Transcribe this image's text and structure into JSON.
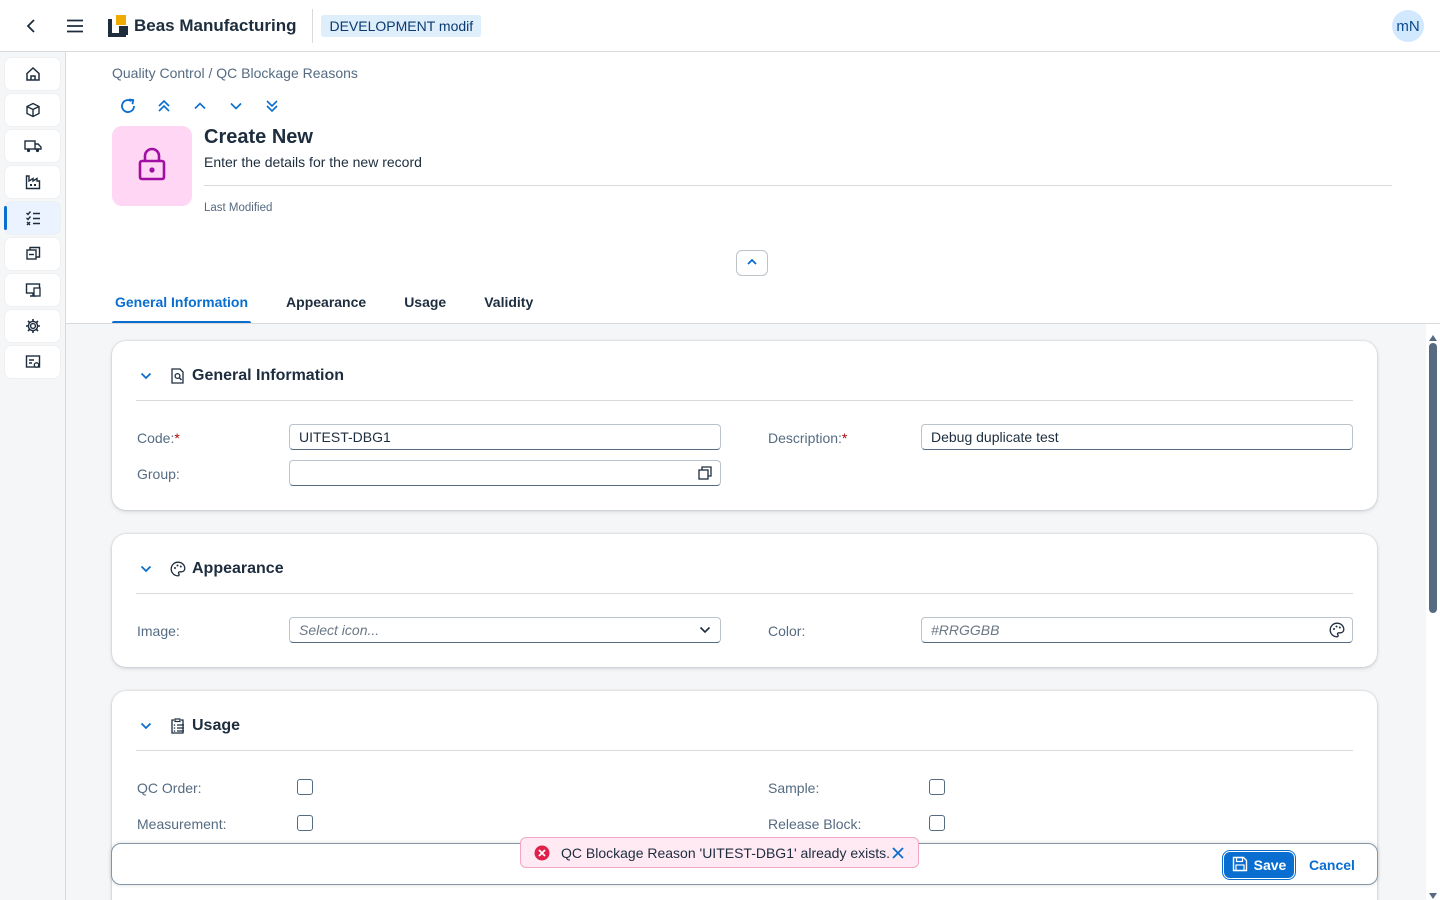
{
  "shell": {
    "app_title": "Beas Manufacturing",
    "environment": "DEVELOPMENT modif",
    "user_initials": "mN"
  },
  "sidenav": {
    "items": [
      {
        "icon": "home-icon",
        "active": false
      },
      {
        "icon": "cube-icon",
        "active": false
      },
      {
        "icon": "truck-icon",
        "active": false
      },
      {
        "icon": "factory-icon",
        "active": false
      },
      {
        "icon": "checklist-icon",
        "active": true
      },
      {
        "icon": "product-icon",
        "active": false
      },
      {
        "icon": "monitor-icon",
        "active": false
      },
      {
        "icon": "gear-icon",
        "active": false
      },
      {
        "icon": "report-icon",
        "active": false
      }
    ]
  },
  "breadcrumb": {
    "parent": "Quality Control",
    "separator": " / ",
    "current": "QC Blockage Reasons"
  },
  "header": {
    "title": "Create New",
    "subtitle": "Enter the details for the new record",
    "last_modified_label": "Last Modified",
    "avatar_icon": "lock-icon",
    "avatar_color": "#ffd6f3"
  },
  "tabs": [
    {
      "label": "General Information",
      "active": true
    },
    {
      "label": "Appearance",
      "active": false
    },
    {
      "label": "Usage",
      "active": false
    },
    {
      "label": "Validity",
      "active": false
    }
  ],
  "sections": {
    "general": {
      "title": "General Information",
      "code_label": "Code:",
      "code_value": "UITEST-DBG1",
      "description_label": "Description:",
      "description_value": "Debug duplicate test",
      "group_label": "Group:",
      "group_value": "",
      "required_marker": "*"
    },
    "appearance": {
      "title": "Appearance",
      "image_label": "Image:",
      "image_placeholder": "Select icon...",
      "color_label": "Color:",
      "color_placeholder": "#RRGGBB"
    },
    "usage": {
      "title": "Usage",
      "qc_order_label": "QC Order:",
      "qc_order_checked": false,
      "sample_label": "Sample:",
      "sample_checked": false,
      "measurement_label": "Measurement:",
      "measurement_checked": false,
      "release_block_label": "Release Block:",
      "release_block_checked": false
    }
  },
  "footer": {
    "save_label": "Save",
    "cancel_label": "Cancel"
  },
  "toast": {
    "type": "error",
    "message": "QC Blockage Reason 'UITEST-DBG1' already exists."
  },
  "colors": {
    "accent": "#0a6ed1",
    "error": "#e0204a",
    "avatar_icon": "#a10ea4"
  }
}
